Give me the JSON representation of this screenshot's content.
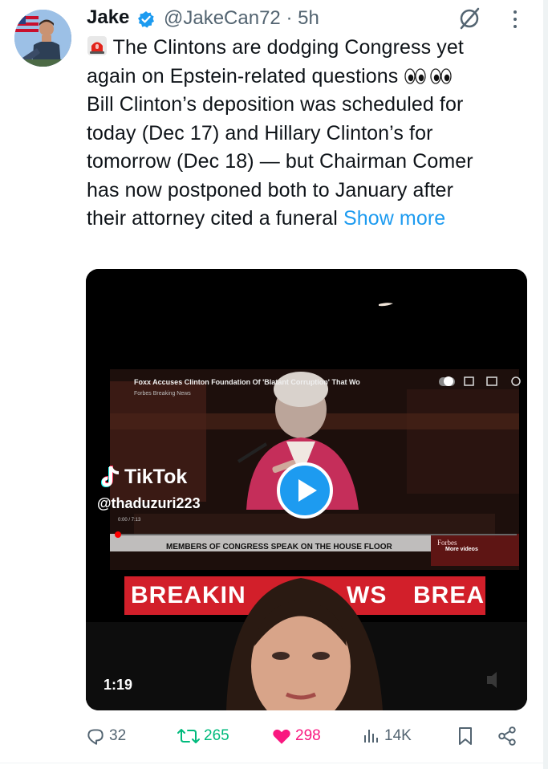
{
  "author": {
    "display_name": "Jake",
    "handle_time": "@JakeCan72 · 5h",
    "verified_badge_color": "#1d9bf0"
  },
  "tweet": {
    "line1": "The Clintons are dodging Congress yet",
    "line2": "again on Epstein-related questions",
    "line3": "Bill Clinton’s deposition was scheduled for",
    "line4": "today (Dec 17) and Hillary Clinton’s for",
    "line5": "tomorrow (Dec 18) — but Chairman Comer",
    "line6": "has now postponed both to January after",
    "line7": "their attorney cited a funeral",
    "show_more": "Show more",
    "icons": [
      "siren-emoji",
      "eyes-emoji",
      "eyes-emoji"
    ]
  },
  "video": {
    "embedded_title": "Foxx Accuses Clinton Foundation Of 'Blatant Corruption' That Wo",
    "embedded_channel": "Forbes Breaking News",
    "embedded_time": "0:00 / 7:13",
    "lower_third": "MEMBERS OF CONGRESS SPEAK ON THE HOUSE FLOOR",
    "more_videos": "More videos",
    "forbes_brand": "Forbes",
    "tiktok_brand": "TikTok",
    "tiktok_user": "@thaduzuri223",
    "banner_left": "BREAKIN",
    "banner_mid": "WS",
    "banner_right": "BREA",
    "duration": "1:19"
  },
  "actions": {
    "replies": "32",
    "reposts": "265",
    "likes": "298",
    "views": "14K",
    "reply_color": "#536471",
    "repost_color": "#00ba7c",
    "like_color": "#f91880"
  }
}
